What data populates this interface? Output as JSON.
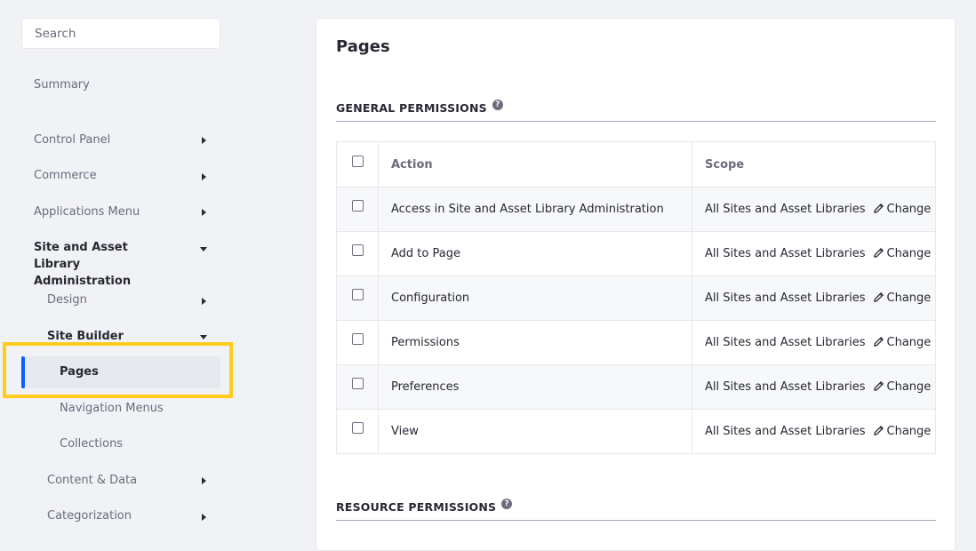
{
  "search": {
    "placeholder": "Search"
  },
  "sidebar": {
    "summary": "Summary",
    "control_panel": "Control Panel",
    "commerce": "Commerce",
    "applications_menu": "Applications Menu",
    "site_admin": "Site and Asset Library Administration",
    "design": "Design",
    "site_builder": "Site Builder",
    "pages": "Pages",
    "navigation_menus": "Navigation Menus",
    "collections": "Collections",
    "content_data": "Content & Data",
    "categorization": "Categorization"
  },
  "main": {
    "title": "Pages",
    "general_permissions": "GENERAL PERMISSIONS",
    "resource_permissions": "RESOURCE PERMISSIONS",
    "help_glyph": "?",
    "columns": {
      "action": "Action",
      "scope": "Scope"
    },
    "rows": [
      {
        "action": "Access in Site and Asset Library Administration",
        "scope": "All Sites and Asset Libraries",
        "change": "Change"
      },
      {
        "action": "Add to Page",
        "scope": "All Sites and Asset Libraries",
        "change": "Change"
      },
      {
        "action": "Configuration",
        "scope": "All Sites and Asset Libraries",
        "change": "Change"
      },
      {
        "action": "Permissions",
        "scope": "All Sites and Asset Libraries",
        "change": "Change"
      },
      {
        "action": "Preferences",
        "scope": "All Sites and Asset Libraries",
        "change": "Change"
      },
      {
        "action": "View",
        "scope": "All Sites and Asset Libraries",
        "change": "Change"
      }
    ]
  },
  "colors": {
    "accent": "#0b5fff",
    "highlight": "#ffcc1e"
  },
  "icons": {
    "caret_collapsed": "caret-right-icon",
    "caret_expanded": "caret-down-icon",
    "edit": "pencil-icon",
    "help": "question-circle-icon"
  }
}
